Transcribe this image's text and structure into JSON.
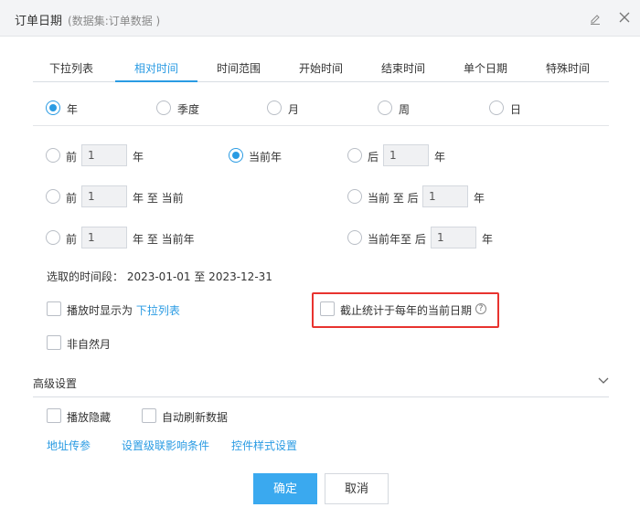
{
  "dialog": {
    "title": "订单日期",
    "subtitle": "(数据集:订单数据 )"
  },
  "tabs": [
    {
      "label": "下拉列表",
      "active": false
    },
    {
      "label": "相对时间",
      "active": true
    },
    {
      "label": "时间范围",
      "active": false
    },
    {
      "label": "开始时间",
      "active": false
    },
    {
      "label": "结束时间",
      "active": false
    },
    {
      "label": "单个日期",
      "active": false
    },
    {
      "label": "特殊时间",
      "active": false
    }
  ],
  "granularity": {
    "selected": "年",
    "options": [
      "年",
      "季度",
      "月",
      "周",
      "日"
    ]
  },
  "relative": {
    "row1": {
      "prev_label": "前",
      "prev_value": "1",
      "prev_unit": "年",
      "current_label": "当前年",
      "next_label": "后",
      "next_value": "1",
      "next_unit": "年"
    },
    "row2": {
      "prev_label": "前",
      "prev_value": "1",
      "prev_suffix": "年 至 当前",
      "next_label": "当前 至 后",
      "next_value": "1",
      "next_unit": "年"
    },
    "row3": {
      "prev_label": "前",
      "prev_value": "1",
      "prev_suffix": "年 至 当前年",
      "next_label": "当前年至 后",
      "next_value": "1",
      "next_unit": "年"
    }
  },
  "selected_range": "选取的时间段： 2023-01-01 至 2023-12-31",
  "options": {
    "display_as_prefix": "播放时显示为",
    "display_as_link": "下拉列表",
    "cutoff_label": "截止统计于每年的当前日期",
    "non_natural_month": "非自然月"
  },
  "advanced": {
    "title": "高级设置",
    "hide_on_play": "播放隐藏",
    "auto_refresh": "自动刷新数据",
    "links": [
      "地址传参",
      "设置级联影响条件",
      "控件样式设置"
    ]
  },
  "buttons": {
    "ok": "确定",
    "cancel": "取消"
  },
  "colors": {
    "accent": "#2a9be3",
    "primary_button": "#3aa9ef",
    "highlight_border": "#e8332f"
  }
}
